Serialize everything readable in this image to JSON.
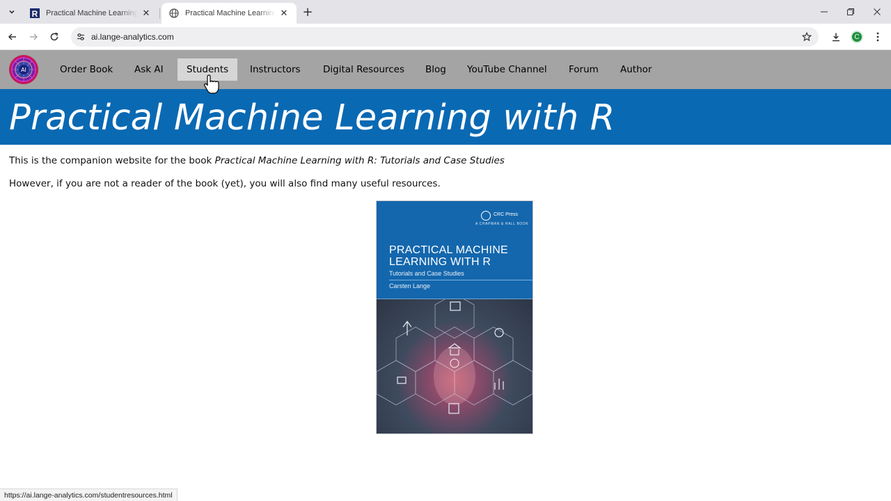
{
  "browser": {
    "tabs": [
      {
        "title": "Practical Machine Learning with R",
        "favicon": "r-letter-icon",
        "active": false
      },
      {
        "title": "Practical Machine Learning with R",
        "favicon": "globe-icon",
        "active": true
      }
    ],
    "url": "ai.lange-analytics.com",
    "profile_initial": "C",
    "status_url": "https://ai.lange-analytics.com/studentresources.html"
  },
  "site": {
    "logo_text": "AI",
    "nav": [
      {
        "label": "Order Book"
      },
      {
        "label": "Ask AI"
      },
      {
        "label": "Students",
        "hovered": true
      },
      {
        "label": "Instructors"
      },
      {
        "label": "Digital Resources"
      },
      {
        "label": "Blog"
      },
      {
        "label": "YouTube Channel"
      },
      {
        "label": "Forum"
      },
      {
        "label": "Author"
      }
    ],
    "banner_title": "Practical Machine Learning with R",
    "intro_prefix": "This is the companion website for the book ",
    "intro_book": "Practical Machine Learning with R: Tutorials and Case Studies",
    "intro2": "However, if you are not a reader of the book (yet), you will also find many useful resources.",
    "cover": {
      "title": "PRACTICAL MACHINE\nLEARNING WITH R",
      "subtitle": "Tutorials and Case Studies",
      "author": "Carsten Lange",
      "publisher": "CRC Press",
      "imprint": "A CHAPMAN & HALL BOOK"
    }
  },
  "colors": {
    "nav_bg": "#a4a4a4",
    "nav_hover": "#d6d6d6",
    "banner_bg": "#0a69b3",
    "profile": "#1e8e3e"
  }
}
